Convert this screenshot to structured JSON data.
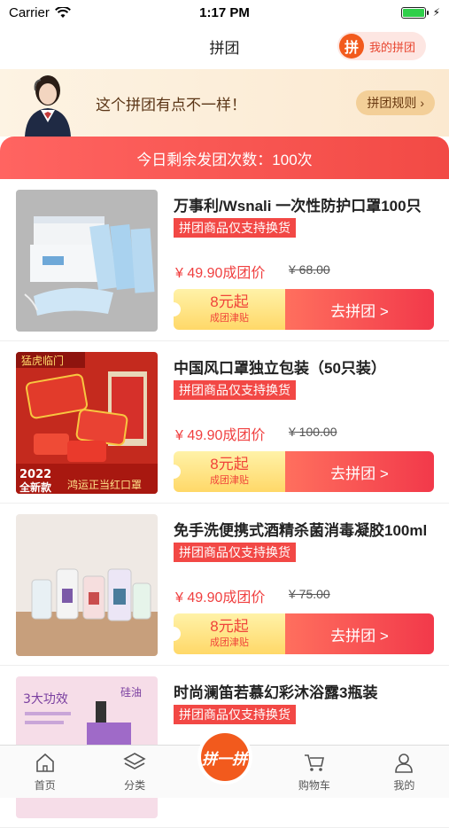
{
  "status_bar": {
    "carrier": "Carrier",
    "time": "1:17 PM"
  },
  "nav": {
    "title": "拼团",
    "my_group_label": "我的拼团",
    "pin_char": "拼"
  },
  "banner": {
    "text": "这个拼团有点不一样！",
    "rules_label": "拼团规则"
  },
  "remaining": {
    "text": "今日剩余发团次数：100次"
  },
  "products": [
    {
      "title": "万事利/Wsnali 一次性防护口罩100只",
      "tag": "拼团商品仅支持换货",
      "price": "¥ 49.90成团价",
      "original_price": "¥ 68.00",
      "subsidy_amount": "8元起",
      "subsidy_label": "成团津贴",
      "button": "去拼团 >"
    },
    {
      "title": "中国风口罩独立包装（50只装）",
      "tag": "拼团商品仅支持换货",
      "price": "¥ 49.90成团价",
      "original_price": "¥ 100.00",
      "subsidy_amount": "8元起",
      "subsidy_label": "成团津贴",
      "button": "去拼团 >",
      "image_text": [
        "猛虎临门",
        "2022",
        "全新款",
        "鸿运正当红口罩"
      ]
    },
    {
      "title": "免手洗便携式酒精杀菌消毒凝胶100ml",
      "tag": "拼团商品仅支持换货",
      "price": "¥ 49.90成团价",
      "original_price": "¥ 75.00",
      "subsidy_amount": "8元起",
      "subsidy_label": "成团津贴",
      "button": "去拼团 >"
    },
    {
      "title": "时尚澜笛若慕幻彩沐浴露3瓶装",
      "tag": "拼团商品仅支持换货",
      "image_text": [
        "3大功效",
        "硅油"
      ]
    }
  ],
  "tabs": [
    "首页",
    "分类",
    "购物车",
    "我的"
  ],
  "center_tab": {
    "label": "拼一拼"
  },
  "colors": {
    "accent": "#f24845",
    "brand_orange": "#f25a1d"
  }
}
